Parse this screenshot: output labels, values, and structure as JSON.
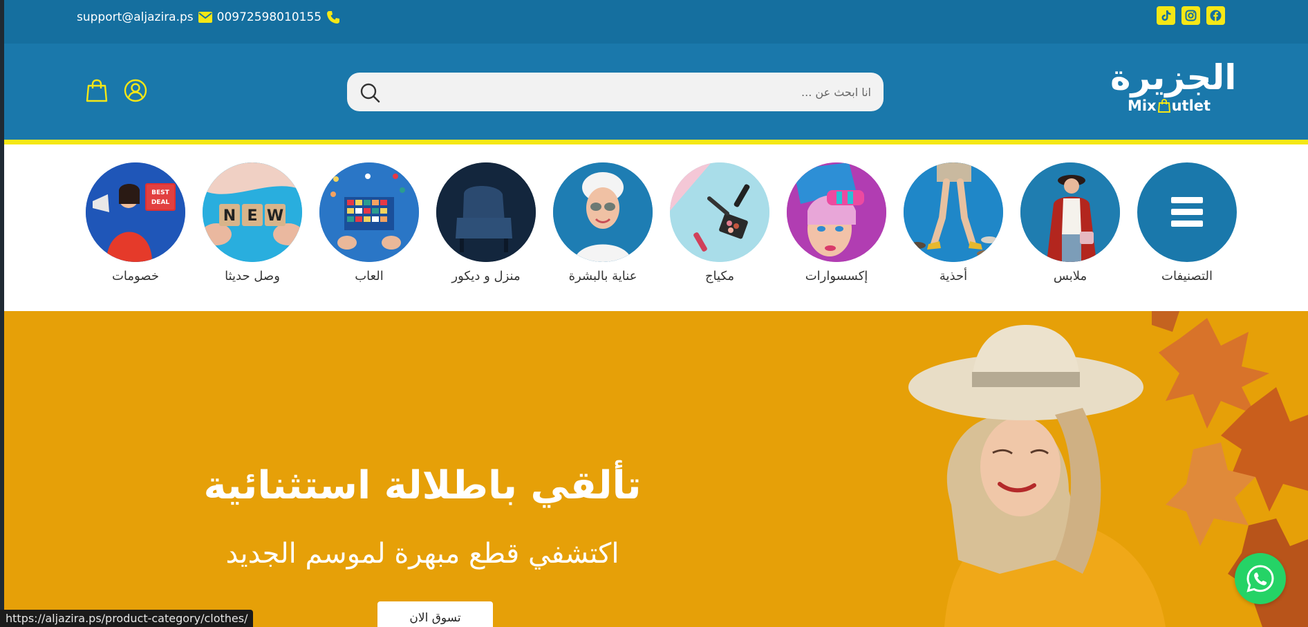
{
  "topbar": {
    "email": "support@aljazira.ps",
    "phone": "00972598010155",
    "email_icon": "envelope-icon",
    "phone_icon": "phone-icon",
    "socials": [
      "tiktok-icon",
      "instagram-icon",
      "facebook-icon"
    ]
  },
  "header": {
    "logo_ar": "الجزيرة",
    "logo_en_1": "Mix ",
    "logo_en_2": "utlet",
    "search_placeholder": "انا ابحث عن ...",
    "account_icon": "user-icon",
    "cart_icon": "shopping-bag-icon"
  },
  "categories": [
    {
      "label": "التصنيفات"
    },
    {
      "label": "ملابس"
    },
    {
      "label": "أحذية"
    },
    {
      "label": "إكسسوارات"
    },
    {
      "label": "مكياج"
    },
    {
      "label": "عناية بالبشرة"
    },
    {
      "label": "منزل و ديكور"
    },
    {
      "label": "العاب"
    },
    {
      "label": "وصل حديثا"
    },
    {
      "label": "خصومات"
    }
  ],
  "hero": {
    "title": "تألقي باطلالة استثنائية",
    "subtitle": "اكتشفي قطع مبهرة لموسم الجديد",
    "button": "تسوق الان"
  },
  "new_tiles": [
    "N",
    "E",
    "W"
  ],
  "deal_tag": [
    "BEST",
    "DEAL"
  ],
  "status_url": "https://aljazira.ps/product-category/clothes/",
  "colors": {
    "topbar": "#156f9f",
    "header": "#1a78ab",
    "accent": "#f5e716",
    "hero": "#e6a008",
    "whatsapp": "#25d366"
  }
}
